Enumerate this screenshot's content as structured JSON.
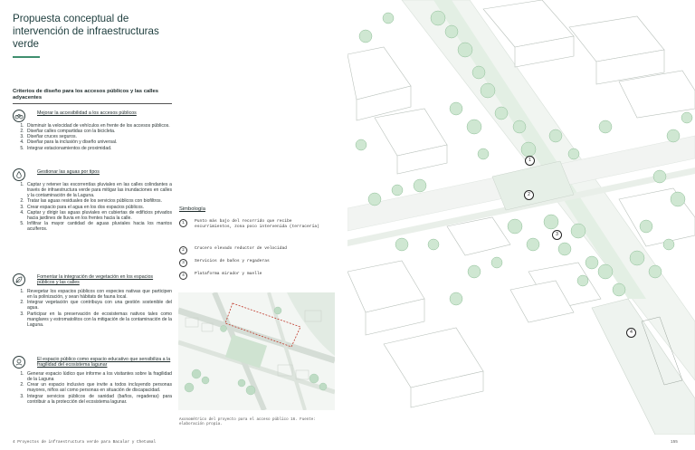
{
  "title": "Propuesta conceptual de intervención de infraestructuras verde",
  "criteria_heading": "Criterios de diseño para los accesos públicos y las calles adyacentes",
  "sections": [
    {
      "icon": "bicycle-icon",
      "title": "Mejorar la accesibilidad a los accesos públicos",
      "items": [
        "Disminuir la velocidad de vehículos en frente de los accesos públicos.",
        "Diseñar calles compartidas con la bicicleta.",
        "Diseñar cruces seguros.",
        "Diseñar para la inclusión y diseño universal.",
        "Integrar estacionamientos de proximidad."
      ]
    },
    {
      "icon": "water-drop-icon",
      "title": "Gestionar las aguas por tipos",
      "items": [
        "Captar y retener las escorrentías pluviales en las calles colindantes a través de infraestructura verde para mitigar las inundaciones en calles y la contaminación de la Laguna.",
        "Tratar las aguas residuales de los servicios públicos con biofiltros.",
        "Crear espacio para el agua en los dos espacios públicos.",
        "Captar y dirigir las aguas pluviales en cubiertas de edificios privados hacia jardines de lluvia en los frentes hacia la calle.",
        "Infiltrar la mayor cantidad de aguas pluviales hacia los mantos acuíferos."
      ]
    },
    {
      "icon": "leaf-icon",
      "title": "Fomentar la integración de vegetación en los espacios públicos y las calles",
      "items": [
        "Revegetar los espacios públicos con especies nativas que participen en la polinización, y sean hábitats de fauna local.",
        "Integrar vegetación que contribuya con una gestión sostenible del agua.",
        "Participar en la preservación de ecosistemas nativos tales como manglares y estromatolitos con la mitigación de la contaminación de la Laguna."
      ]
    },
    {
      "icon": "education-icon",
      "title": "El espacio público como espacio educativo que sensibiliza a la fragilidad del ecosistema lagunar",
      "items": [
        "Generar espacio lúdico que informe a los visitantes sobre la fragilidad de la Laguna",
        "Crear un espacio inclusivo que invite a todos incluyendo personas mayores, niños así como personas en situación de discapacidad.",
        "Integrar servicios públicos de sanidad (baños, regaderas) para contribuir a la protección del ecosistema lagunar."
      ]
    }
  ],
  "symbology": {
    "heading": "Simbología",
    "items": [
      {
        "num": "1",
        "text": "Punto más bajo del recorrido que recibe escurrimientos, zona poco intervenida (terracería)"
      },
      {
        "num": "2",
        "text": "Crucero elevado reductor de velocidad"
      },
      {
        "num": "3",
        "text": "Servicios de baños y regaderas"
      },
      {
        "num": "4",
        "text": "Plataforma mirador y muelle"
      }
    ]
  },
  "caption": "Axonométrico del proyecto para el acceso público 16. Fuente: elaboración propia.",
  "footer": {
    "left": "4     Proyectos de infraestructura verde para Bacalar y Chetumal",
    "right": "155"
  },
  "markers": [
    "1",
    "2",
    "3",
    "4"
  ],
  "colors": {
    "accent": "#3f8f6f",
    "tree": "#cfe7d2",
    "tree_stroke": "#8fbf98"
  }
}
